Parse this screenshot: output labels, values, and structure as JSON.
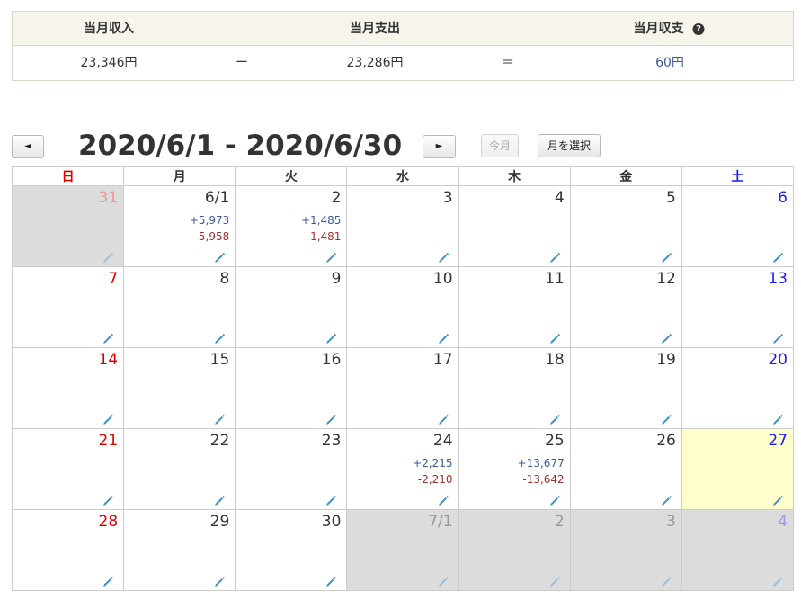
{
  "summary": {
    "income_label": "当月収入",
    "expense_label": "当月支出",
    "balance_label": "当月収支",
    "help_icon": "?",
    "income_value": "23,346円",
    "minus_sign": "ー",
    "expense_value": "23,286円",
    "equals_sign": "＝",
    "balance_value": "60円"
  },
  "nav": {
    "prev_label": "◄",
    "title": "2020/6/1 - 2020/6/30",
    "next_label": "►",
    "today_label": "今月",
    "select_month_label": "月を選択"
  },
  "weekdays": [
    "日",
    "月",
    "火",
    "水",
    "木",
    "金",
    "土"
  ],
  "weeks": [
    [
      {
        "day": "31",
        "other": true
      },
      {
        "day": "6/1",
        "income": "+5,973",
        "expense": "-5,958"
      },
      {
        "day": "2",
        "income": "+1,485",
        "expense": "-1,481"
      },
      {
        "day": "3"
      },
      {
        "day": "4"
      },
      {
        "day": "5"
      },
      {
        "day": "6"
      }
    ],
    [
      {
        "day": "7"
      },
      {
        "day": "8"
      },
      {
        "day": "9"
      },
      {
        "day": "10"
      },
      {
        "day": "11"
      },
      {
        "day": "12"
      },
      {
        "day": "13"
      }
    ],
    [
      {
        "day": "14"
      },
      {
        "day": "15"
      },
      {
        "day": "16"
      },
      {
        "day": "17"
      },
      {
        "day": "18"
      },
      {
        "day": "19"
      },
      {
        "day": "20"
      }
    ],
    [
      {
        "day": "21"
      },
      {
        "day": "22"
      },
      {
        "day": "23"
      },
      {
        "day": "24",
        "income": "+2,215",
        "expense": "-2,210"
      },
      {
        "day": "25",
        "income": "+13,677",
        "expense": "-13,642"
      },
      {
        "day": "26"
      },
      {
        "day": "27",
        "today": true
      }
    ],
    [
      {
        "day": "28"
      },
      {
        "day": "29"
      },
      {
        "day": "30"
      },
      {
        "day": "7/1",
        "other": true
      },
      {
        "day": "2",
        "other": true
      },
      {
        "day": "3",
        "other": true
      },
      {
        "day": "4",
        "other": true
      }
    ]
  ],
  "colors": {
    "income": "#3a5a9a",
    "expense": "#a03030",
    "sunday": "#e00000",
    "saturday": "#1a1aff",
    "today_bg": "#ffffcc",
    "other_month_bg": "#dcdcdc",
    "edit_icon": "#3a8fd0"
  },
  "icons": {
    "edit": "pencil-icon",
    "help": "question-circle-icon"
  }
}
